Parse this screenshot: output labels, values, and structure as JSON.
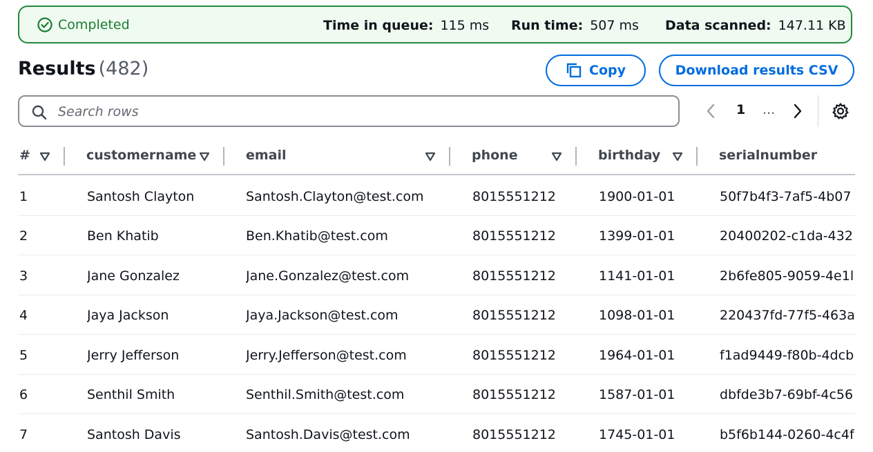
{
  "status": {
    "state": "Completed",
    "metrics": [
      {
        "label": "Time in queue:",
        "value": "115 ms"
      },
      {
        "label": "Run time:",
        "value": "507 ms"
      },
      {
        "label": "Data scanned:",
        "value": "147.11 KB"
      }
    ]
  },
  "results": {
    "title": "Results",
    "count": "(482)",
    "copy_label": "Copy",
    "download_label": "Download results CSV"
  },
  "search": {
    "placeholder": "Search rows"
  },
  "pagination": {
    "current_page": "1",
    "ellipsis": "..."
  },
  "table": {
    "columns": [
      "#",
      "customername",
      "email",
      "phone",
      "birthday",
      "serialnumber"
    ],
    "rows": [
      [
        "1",
        "Santosh Clayton",
        "Santosh.Clayton@test.com",
        "8015551212",
        "1900-01-01",
        "50f7b4f3-7af5-4b07"
      ],
      [
        "2",
        "Ben Khatib",
        "Ben.Khatib@test.com",
        "8015551212",
        "1399-01-01",
        "20400202-c1da-432"
      ],
      [
        "3",
        "Jane Gonzalez",
        "Jane.Gonzalez@test.com",
        "8015551212",
        "1141-01-01",
        "2b6fe805-9059-4e1l"
      ],
      [
        "4",
        "Jaya Jackson",
        "Jaya.Jackson@test.com",
        "8015551212",
        "1098-01-01",
        "220437fd-77f5-463a"
      ],
      [
        "5",
        "Jerry Jefferson",
        "Jerry.Jefferson@test.com",
        "8015551212",
        "1964-01-01",
        "f1ad9449-f80b-4dcb"
      ],
      [
        "6",
        "Senthil Smith",
        "Senthil.Smith@test.com",
        "8015551212",
        "1587-01-01",
        "dbfde3b7-69bf-4c56"
      ],
      [
        "7",
        "Santosh Davis",
        "Santosh.Davis@test.com",
        "8015551212",
        "1745-01-01",
        "b5f6b144-0260-4c4f"
      ]
    ]
  },
  "colors": {
    "success": "#1f8a3a",
    "accent": "#006ce0"
  }
}
